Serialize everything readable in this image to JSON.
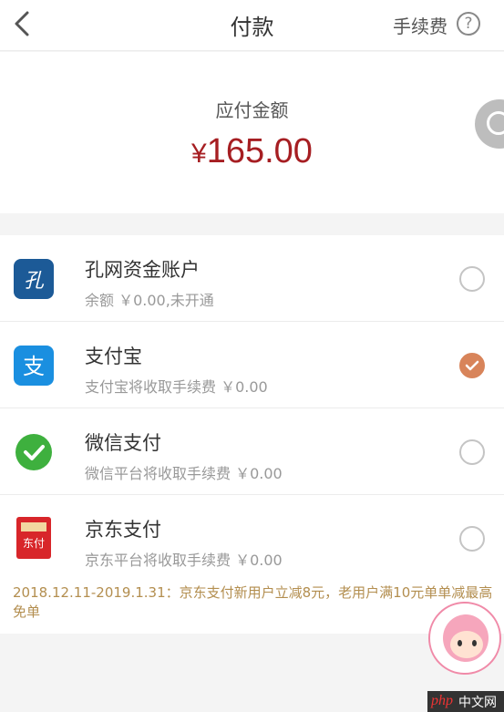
{
  "header": {
    "title": "付款",
    "fee_label": "手续费",
    "help_glyph": "?"
  },
  "amount": {
    "label": "应付金额",
    "currency": "¥",
    "value": "165.00",
    "color": "#a61e22"
  },
  "payment_methods": [
    {
      "name": "孔网资金账户",
      "sub": "余额 ￥0.00,未开通",
      "icon": "kongwang-icon",
      "icon_text": "孔",
      "selected": false
    },
    {
      "name": "支付宝",
      "sub": "支付宝将收取手续费 ￥0.00",
      "icon": "alipay-icon",
      "icon_text": "支",
      "selected": true
    },
    {
      "name": "微信支付",
      "sub": "微信平台将收取手续费 ￥0.00",
      "icon": "wechat-pay-icon",
      "icon_text": "",
      "selected": false
    },
    {
      "name": "京东支付",
      "sub": "京东平台将收取手续费 ￥0.00",
      "icon": "jd-pay-icon",
      "icon_text": "东付",
      "selected": false
    }
  ],
  "promo": "2018.12.11-2019.1.31：京东支付新用户立减8元，老用户满10元单单减最高免单",
  "watermark": {
    "php": "php",
    "cn": "中文网"
  },
  "colors": {
    "accent": "#d8845a",
    "promo": "#b38e4f",
    "alipay": "#1a8fe0",
    "wechat": "#3eb03e",
    "jd": "#d8262a",
    "kongwang": "#1c5a97"
  }
}
